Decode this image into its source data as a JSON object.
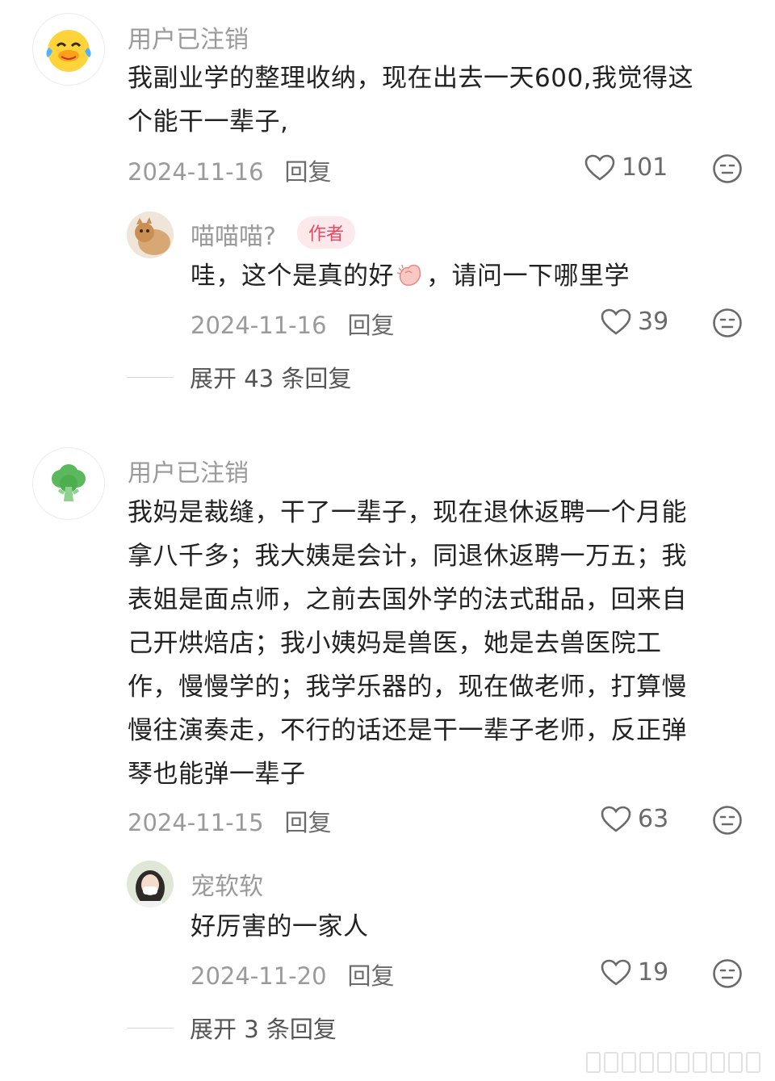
{
  "comments": [
    {
      "username": "用户已注销",
      "text_lines": [
        "我副业学的整理收纳，现在出去一天600,我觉得这",
        "个能干一辈子,"
      ],
      "date": "2024-11-16",
      "reply_label": "回复",
      "likes": "101",
      "reply": {
        "username": "喵喵喵?",
        "badge": "作者",
        "text_before": "哇，这个是真的好",
        "text_after": "，请问一下哪里学",
        "date": "2024-11-16",
        "reply_label": "回复",
        "likes": "39"
      },
      "expand_label": "展开 43 条回复"
    },
    {
      "username": "用户已注销",
      "text_lines": [
        "我妈是裁缝，干了一辈子，现在退休返聘一个月能",
        "拿八千多；我大姨是会计，同退休返聘一万五；我",
        "表姐是面点师，之前去国外学的法式甜品，回来自",
        "己开烘焙店；我小姨妈是兽医，她是去兽医院工",
        "作，慢慢学的；我学乐器的，现在做老师，打算慢",
        "慢往演奏走，不行的话还是干一辈子老师，反正弹",
        "琴也能弹一辈子"
      ],
      "date": "2024-11-15",
      "reply_label": "回复",
      "likes": "63",
      "reply": {
        "username": "宠软软",
        "text": "好厉害的一家人",
        "date": "2024-11-20",
        "reply_label": "回复",
        "likes": "19"
      },
      "expand_label": "展开 3 条回复"
    }
  ],
  "icons": {
    "like": "heart-outline-icon",
    "dislike": "meh-face-icon",
    "avatar1": "laughing-duck-emoji",
    "avatar2": "broccoli-emoji"
  },
  "colors": {
    "author_badge_bg": "#fde8ec",
    "author_badge_text": "#e9475e",
    "muted_text": "#9a9a9a"
  }
}
